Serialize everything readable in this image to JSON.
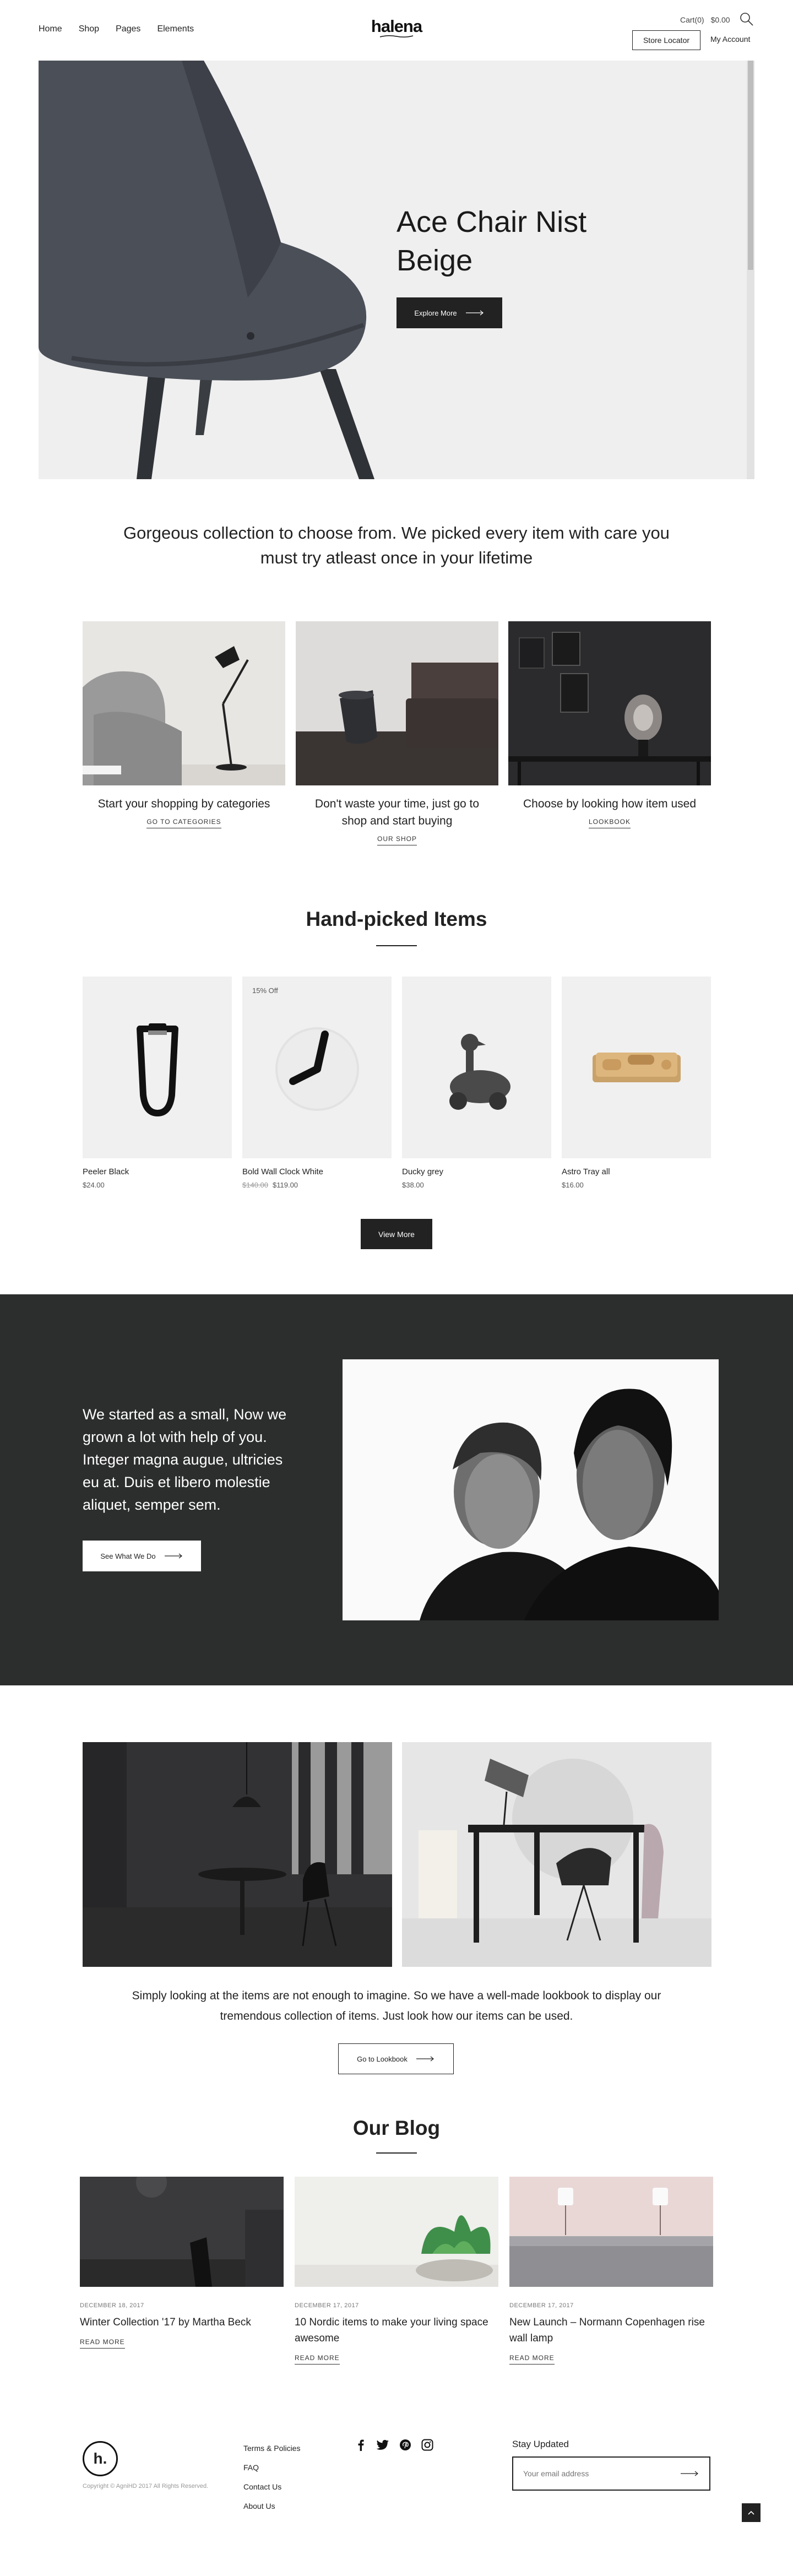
{
  "header": {
    "nav": [
      "Home",
      "Shop",
      "Pages",
      "Elements"
    ],
    "logo": "halena",
    "cart_label": "Cart(0)",
    "cart_total": "$0.00",
    "store_locator": "Store Locator",
    "my_account": "My Account"
  },
  "hero": {
    "title": "Ace Chair Nist Beige",
    "button": "Explore More"
  },
  "intro": "Gorgeous collection to choose from. We picked every item with care you must try atleast once in your lifetime",
  "categories": [
    {
      "text": "Start your shopping by categories",
      "link": "GO TO CATEGORIES"
    },
    {
      "text": "Don't waste your time, just go to shop and start buying",
      "link": "OUR SHOP"
    },
    {
      "text": "Choose by looking how item used",
      "link": "LOOKBOOK"
    }
  ],
  "handpicked": {
    "title": "Hand-picked Items",
    "products": [
      {
        "name": "Peeler Black",
        "price": "$24.00",
        "old_price": "",
        "badge": ""
      },
      {
        "name": "Bold Wall Clock White",
        "price": "$119.00",
        "old_price": "$140.00",
        "badge": "15% Off"
      },
      {
        "name": "Ducky grey",
        "price": "$38.00",
        "old_price": "",
        "badge": ""
      },
      {
        "name": "Astro Tray all",
        "price": "$16.00",
        "old_price": "",
        "badge": ""
      }
    ],
    "view_more": "View More"
  },
  "about": {
    "text": "We started as a small, Now we grown a lot with help of you. Integer magna augue, ultricies eu at. Duis et libero molestie aliquet, semper sem.",
    "button": "See What We Do"
  },
  "lookbook": {
    "text": "Simply looking at the items are not enough to imagine. So we have a well-made lookbook to display our tremendous collection of items. Just look how our items can be used.",
    "button": "Go to Lookbook"
  },
  "blog": {
    "title": "Our Blog",
    "posts": [
      {
        "date": "DECEMBER 18, 2017",
        "title": "Winter Collection '17 by Martha Beck",
        "link": "READ MORE"
      },
      {
        "date": "DECEMBER 17, 2017",
        "title": "10 Nordic items to make your living space awesome",
        "link": "READ MORE"
      },
      {
        "date": "DECEMBER 17, 2017",
        "title": "New Launch – Normann Copenhagen rise wall lamp",
        "link": "READ MORE"
      }
    ]
  },
  "footer": {
    "logo_letter": "h.",
    "copyright": "Copyright © AgniHD 2017 All Rights Reserved.",
    "links": [
      "Terms & Policies",
      "FAQ",
      "Contact Us",
      "About Us"
    ],
    "social_icons": [
      "facebook-icon",
      "twitter-icon",
      "pinterest-icon",
      "instagram-icon"
    ],
    "stay_updated": "Stay Updated",
    "email_placeholder": "Your email address"
  }
}
